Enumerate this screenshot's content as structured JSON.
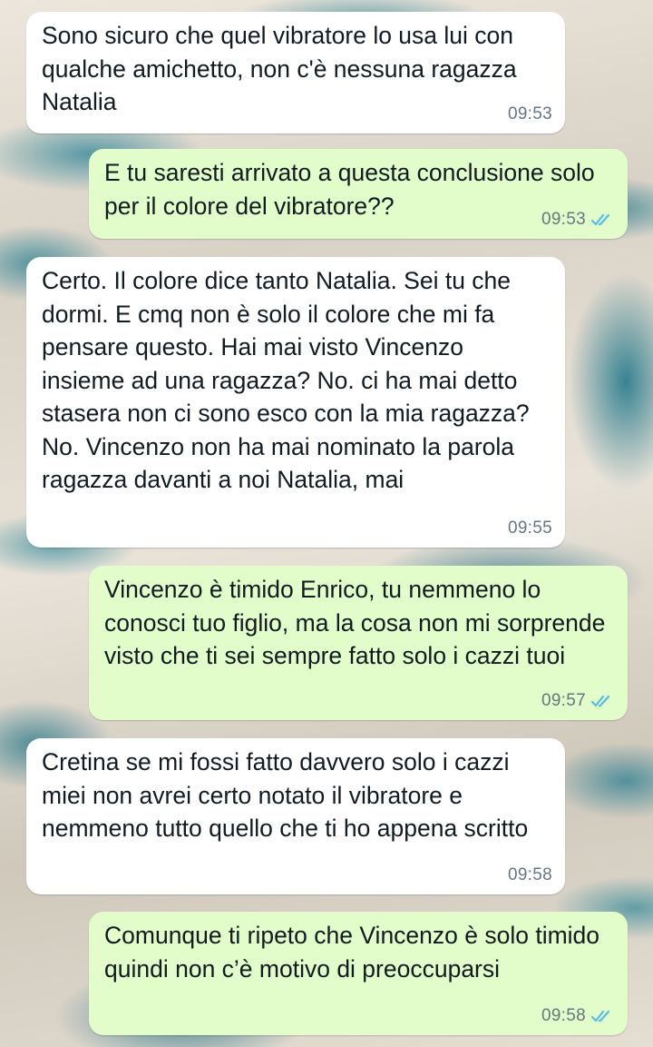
{
  "messages": [
    {
      "direction": "incoming",
      "text": "Sono sicuro che quel vibratore lo usa lui con qualche amichetto, non c'è nessuna ragazza Natalia",
      "time": "09:53"
    },
    {
      "direction": "outgoing",
      "text": "E tu saresti arrivato a questa conclusione solo per il colore del vibratore??",
      "time": "09:53",
      "status": "read"
    },
    {
      "direction": "incoming",
      "text": "Certo. Il colore dice tanto Natalia. Sei tu che dormi. E cmq non è solo il colore che mi fa pensare questo. Hai mai visto Vincenzo insieme ad una ragazza? No. ci ha mai detto stasera non ci sono esco con la mia ragazza? No. Vincenzo non ha mai nominato la parola ragazza davanti a noi Natalia, mai",
      "time": "09:55"
    },
    {
      "direction": "outgoing",
      "text": "Vincenzo è timido Enrico, tu nemmeno lo conosci tuo figlio, ma la cosa non mi sorprende visto che ti sei sempre fatto solo i cazzi tuoi",
      "time": "09:57",
      "status": "read"
    },
    {
      "direction": "incoming",
      "text": "Cretina se mi fossi fatto davvero solo i cazzi miei non avrei certo notato il vibratore e nemmeno tutto quello che ti ho appena scritto",
      "time": "09:58"
    },
    {
      "direction": "outgoing",
      "text": "Comunque ti ripeto che Vincenzo è solo timido quindi non c’è motivo di preoccuparsi",
      "time": "09:58",
      "status": "read"
    }
  ],
  "colors": {
    "incoming_bubble": "#ffffff",
    "outgoing_bubble": "#e2fdc9",
    "text": "#111b21",
    "timestamp": "#667781",
    "read_ticks": "#53bdeb"
  },
  "icons": {
    "read_receipt": "double-check-icon"
  }
}
